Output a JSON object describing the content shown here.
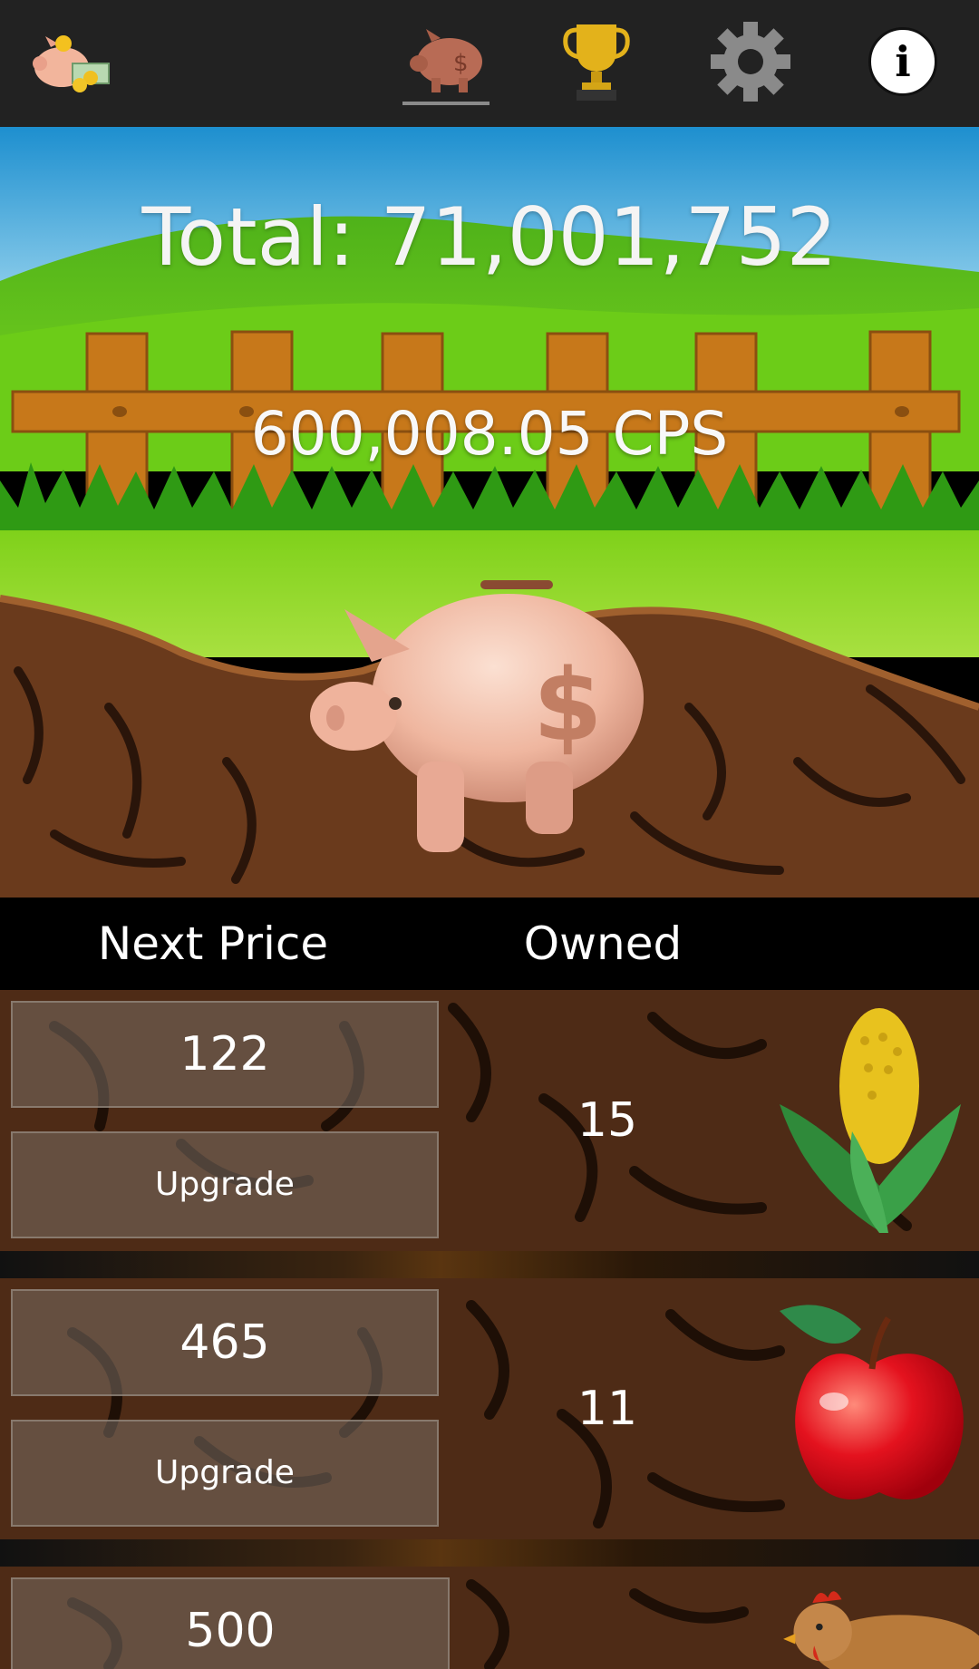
{
  "topbar": {
    "logo_icon": "piggy-bank-cash-icon",
    "tabs": [
      {
        "icon": "piggy-bank-icon",
        "active": true
      },
      {
        "icon": "trophy-icon",
        "active": false
      },
      {
        "icon": "gear-icon",
        "active": false
      }
    ],
    "info_label": "i"
  },
  "scene": {
    "total": "Total: 71,001,752",
    "cps": "600,008.05 CPS",
    "pig_icon": "piggy-bank-icon"
  },
  "list_header": {
    "price_label": "Next Price",
    "owned_label": "Owned"
  },
  "items": [
    {
      "price": "122",
      "upgrade_label": "Upgrade",
      "owned": "15",
      "icon": "corn-icon"
    },
    {
      "price": "465",
      "upgrade_label": "Upgrade",
      "owned": "11",
      "icon": "apple-icon"
    },
    {
      "price": "500",
      "icon": "chicken-icon"
    }
  ],
  "colors": {
    "topbar": "#222222",
    "sky": "#2aa3d8",
    "grass": "#6fcf1a",
    "fence": "#c7781a",
    "dirt": "#5a3018"
  }
}
